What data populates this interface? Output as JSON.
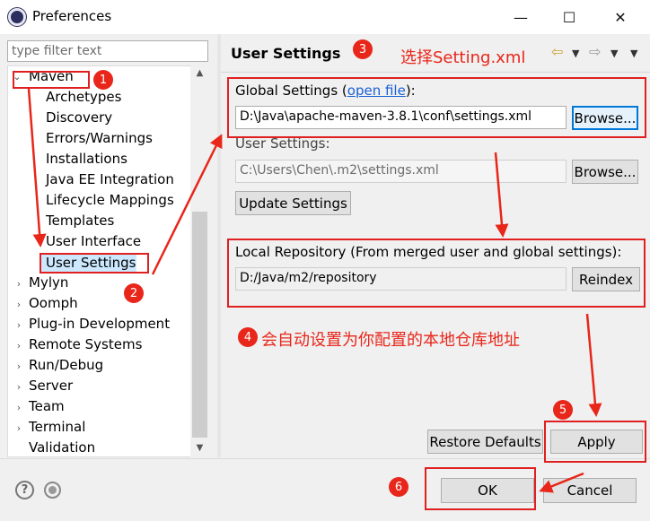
{
  "window": {
    "title": "Preferences",
    "minimize": "—",
    "maximize": "☐",
    "close": "✕"
  },
  "filter": {
    "placeholder": "type filter text"
  },
  "tree": {
    "maven": "Maven",
    "children": [
      "Archetypes",
      "Discovery",
      "Errors/Warnings",
      "Installations",
      "Java EE Integration",
      "Lifecycle Mappings",
      "Templates",
      "User Interface",
      "User Settings"
    ],
    "others": [
      "Mylyn",
      "Oomph",
      "Plug-in Development",
      "Remote Systems",
      "Run/Debug",
      "Server",
      "Team",
      "Terminal",
      "Validation"
    ],
    "selected": "User Settings"
  },
  "page": {
    "title": "User Settings",
    "global_label_pre": "Global Settings (",
    "global_link": "open file",
    "global_label_post": "):",
    "global_value": "D:\\Java\\apache-maven-3.8.1\\conf\\settings.xml",
    "browse1": "Browse...",
    "user_label": "User Settings:",
    "user_value": "C:\\Users\\Chen\\.m2\\settings.xml",
    "browse2": "Browse...",
    "update": "Update Settings",
    "local_label": "Local Repository (From merged user and global settings):",
    "local_value": "D:/Java/m2/repository",
    "reindex": "Reindex",
    "restore": "Restore Defaults",
    "apply": "Apply"
  },
  "footer": {
    "ok": "OK",
    "cancel": "Cancel",
    "help_icon": "?"
  },
  "annotations": {
    "b1": "1",
    "b2": "2",
    "b3": "3",
    "b4": "4",
    "b5": "5",
    "b6": "6",
    "note3": "选择Setting.xml",
    "note4": "会自动设置为你配置的本地仓库地址",
    "color": "#e8261a"
  }
}
